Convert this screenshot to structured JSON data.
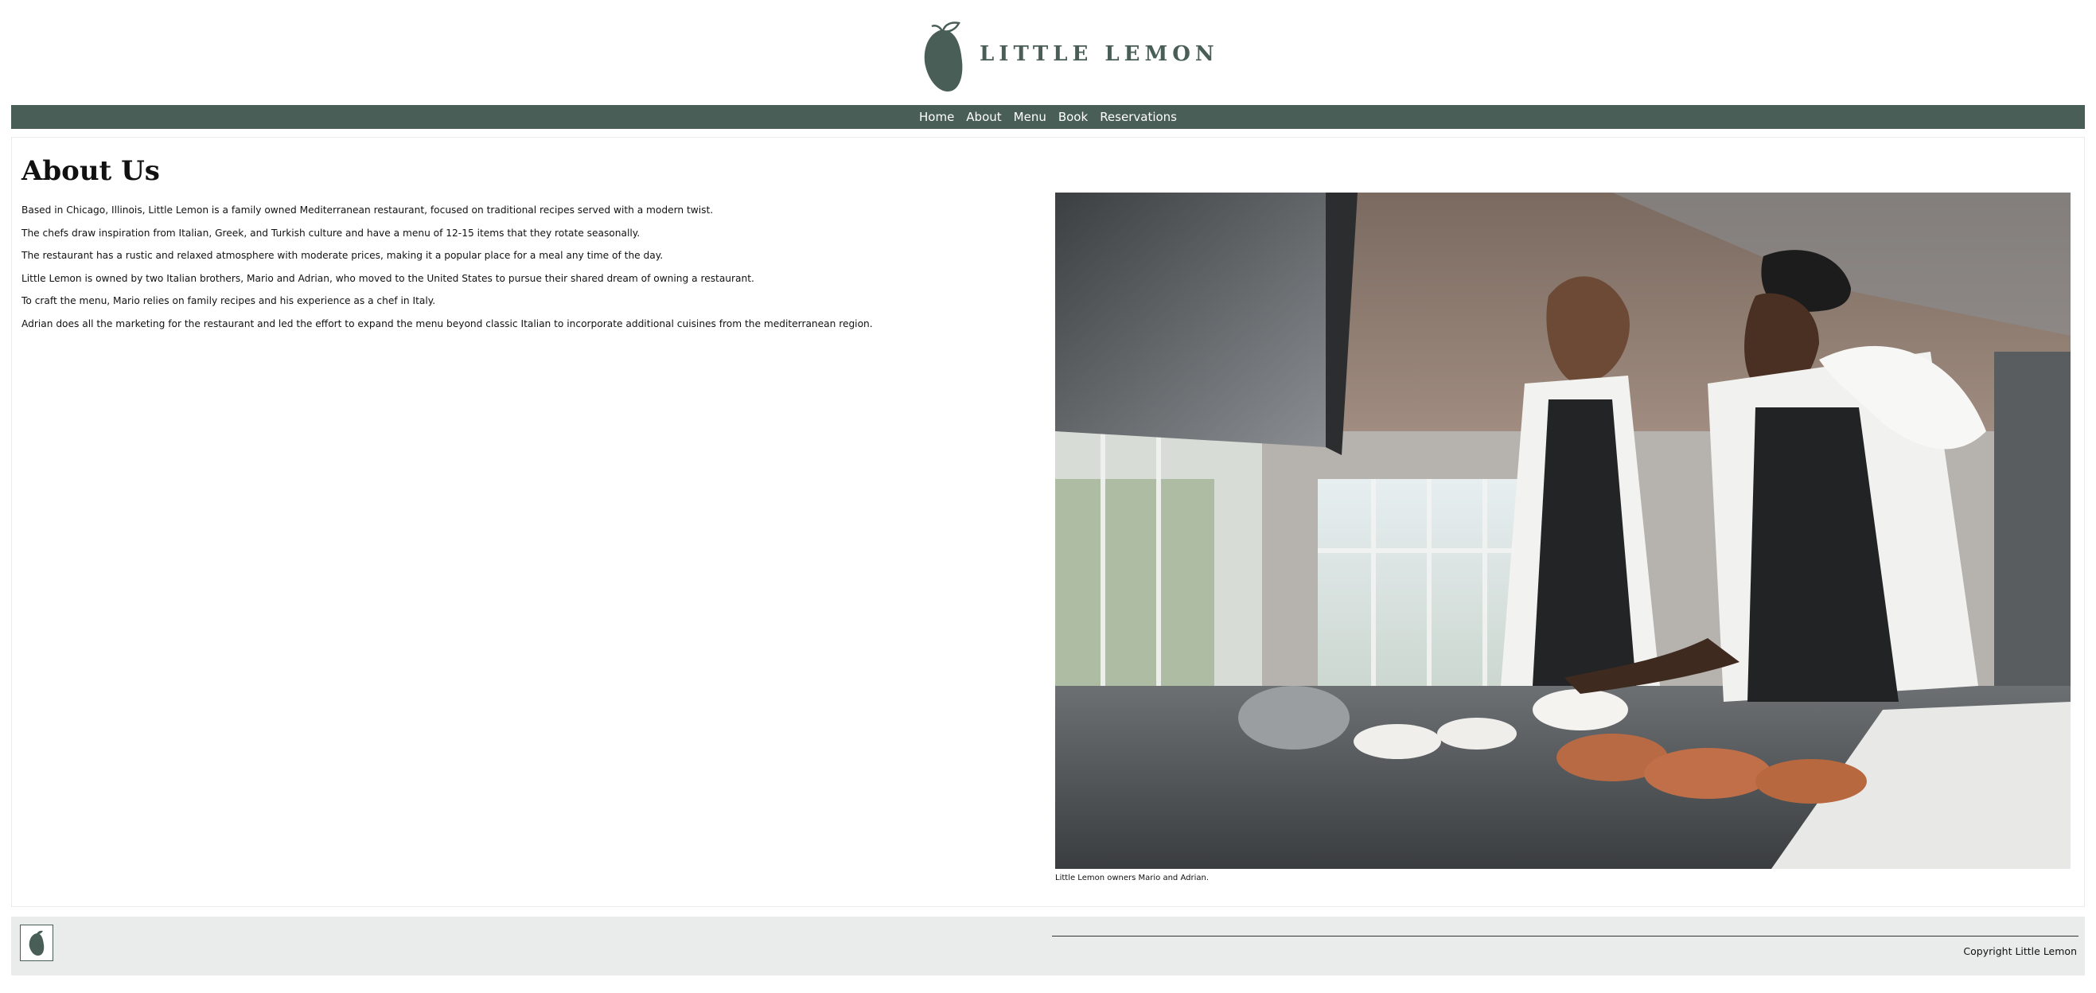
{
  "header": {
    "brand": "LITTLE LEMON",
    "logo_icon": "lemon-icon",
    "brand_color": "#495e57"
  },
  "nav": {
    "items": [
      {
        "label": "Home"
      },
      {
        "label": "About"
      },
      {
        "label": "Menu"
      },
      {
        "label": "Book"
      },
      {
        "label": "Reservations"
      }
    ],
    "background": "#495e57"
  },
  "main": {
    "title": "About Us",
    "paragraphs": [
      "Based in Chicago, Illinois, Little Lemon is a family owned Mediterranean restaurant, focused on traditional recipes served with a modern twist.",
      "The chefs draw inspiration from Italian, Greek, and Turkish culture and have a menu of 12-15 items that they rotate seasonally.",
      "The restaurant has a rustic and relaxed atmosphere with moderate prices, making it a popular place for a meal any time of the day.",
      "Little Lemon is owned by two Italian brothers, Mario and Adrian, who moved to the United States to pursue their shared dream of owning a restaurant.",
      "To craft the menu, Mario relies on family recipes and his experience as a chef in Italy.",
      "Adrian does all the marketing for the restaurant and led the effort to expand the menu beyond classic Italian to incorporate additional cuisines from the mediterranean region."
    ],
    "photo_caption": "Little Lemon owners Mario and Adrian."
  },
  "footer": {
    "logo_icon": "lemon-icon",
    "copyright": "Copyright Little Lemon",
    "background": "#eaecec"
  }
}
